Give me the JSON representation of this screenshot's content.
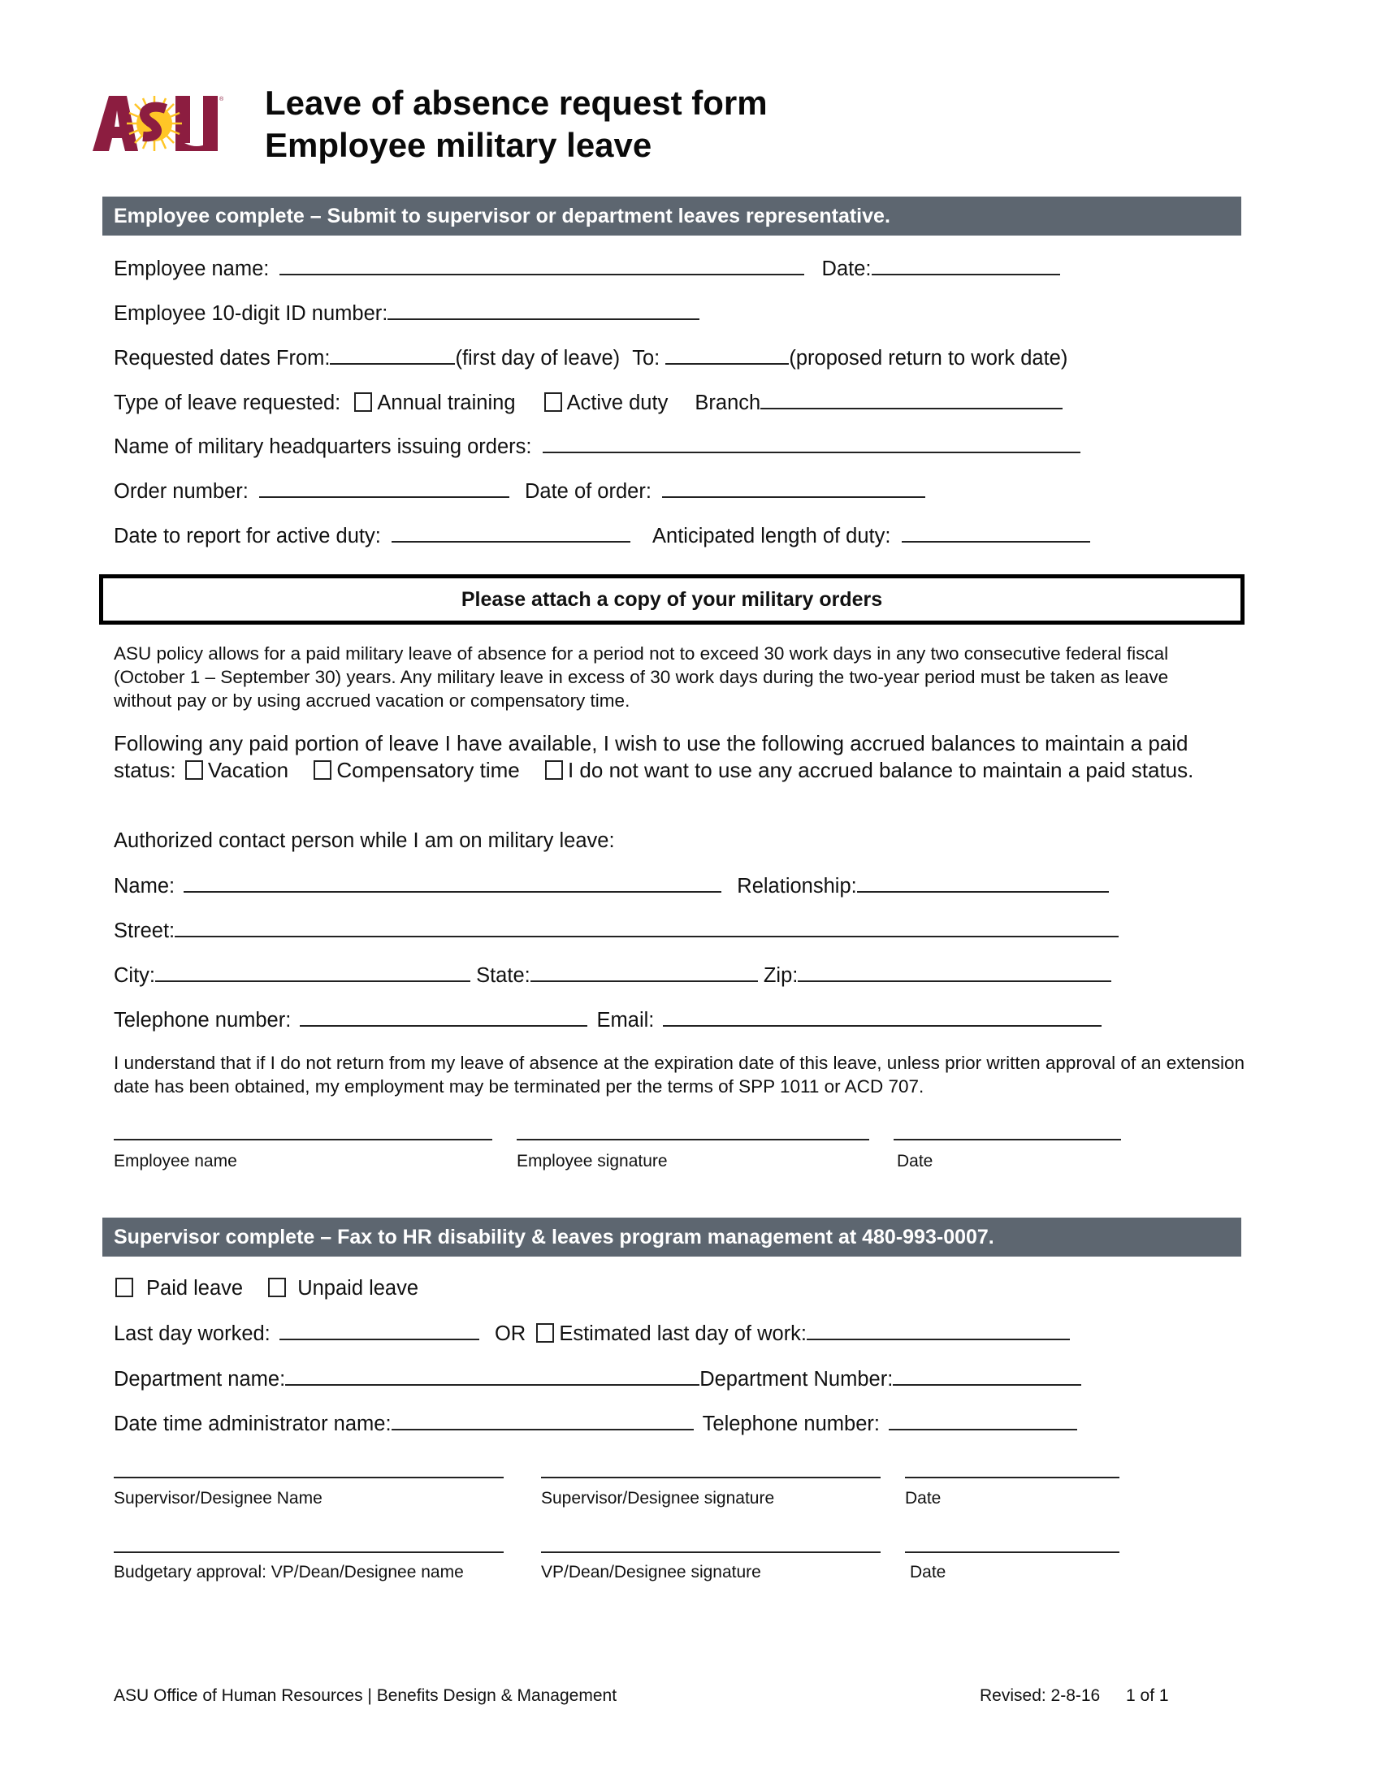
{
  "header": {
    "logo_text": "ASU",
    "title_line1": "Leave of absence request form",
    "title_line2": "Employee military leave"
  },
  "colors": {
    "section_bar": "#5d6670",
    "asu_maroon": "#8c1d40",
    "asu_gold": "#ffc627"
  },
  "employee_section": {
    "bar_title": "Employee complete – Submit to supervisor or department leaves representative.",
    "employee_name_label": "Employee name:",
    "date_label": "Date:",
    "id_label": "Employee 10-digit ID number:",
    "requested_from_label": "Requested dates From:",
    "first_day_note": "(first day of leave)",
    "to_label": "To:",
    "return_note": "(proposed return to work date)",
    "leave_type_label": "Type of leave requested:",
    "annual_training": "Annual training",
    "active_duty": "Active duty",
    "branch_label": "Branch",
    "hq_label": "Name of military headquarters issuing orders:",
    "order_number_label": "Order number:",
    "date_of_order_label": "Date of order:",
    "report_date_label": "Date to report for active duty:",
    "anticipated_length_label": "Anticipated length of duty:",
    "attach_notice": "Please attach a copy of your military orders",
    "policy_text": "ASU policy allows for a paid military leave of absence for a period not to exceed 30 work days in any two consecutive federal fiscal (October 1 – September 30) years. Any military leave in excess of 30 work days during the two-year period must be taken as leave without pay or by using accrued vacation or compensatory time.",
    "accrued_intro": "Following any paid portion of leave I have available, I wish to use the following accrued balances to maintain a paid status:",
    "vacation": "Vacation",
    "comp_time": "Compensatory time",
    "no_accrued": "I do not want to use any accrued balance to maintain a paid status.",
    "contact_heading": "Authorized contact person while I am on military leave:",
    "contact_name_label": "Name:",
    "relationship_label": "Relationship:",
    "street_label": "Street:",
    "city_label": "City:",
    "state_label": "State:",
    "zip_label": "Zip:",
    "telephone_label": "Telephone number:",
    "email_label": "Email:",
    "understand_text": "I understand that if I do not return from my leave of absence at the expiration date of this leave, unless prior written approval of an extension date has been obtained, my employment may be terminated per the terms of SPP 1011 or ACD 707.",
    "sig_labels": [
      "Employee name",
      "Employee signature",
      "Date"
    ]
  },
  "supervisor_section": {
    "bar_title": "Supervisor complete – Fax to HR disability & leaves program management at 480-993-0007.",
    "paid_leave": "Paid leave",
    "unpaid_leave": "Unpaid leave",
    "last_day_label": "Last day worked:",
    "or_label": "OR",
    "estimated_label": "Estimated last day of work:",
    "dept_name_label": "Department name:",
    "dept_number_label": "Department Number:",
    "admin_name_label": "Date time administrator name:",
    "telephone_label": "Telephone number:",
    "sig_labels_1": [
      "Supervisor/Designee Name",
      "Supervisor/Designee signature",
      "Date"
    ],
    "sig_labels_2": [
      "Budgetary approval: VP/Dean/Designee name",
      "VP/Dean/Designee signature",
      "Date"
    ]
  },
  "footer": {
    "left": "ASU Office of Human Resources | Benefits Design & Management",
    "revised": "Revised: 2-8-16",
    "page": "1 of 1"
  }
}
